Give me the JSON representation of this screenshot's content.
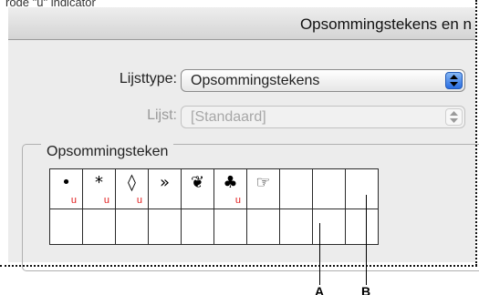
{
  "caption_top": "rode \"u\" indicator",
  "window": {
    "title": "Opsommingstekens en n"
  },
  "list_type": {
    "label": "Lijsttype:",
    "value": "Opsommingstekens",
    "arrow_icon": "up-down-arrows-icon"
  },
  "list": {
    "label": "Lijst:",
    "value": "[Standaard]",
    "arrow_icon": "up-down-arrows-icon"
  },
  "bullet_group": {
    "title": "Opsommingsteken",
    "cells": [
      {
        "symbol": "•",
        "indicator": "u"
      },
      {
        "symbol": "*",
        "indicator": "u"
      },
      {
        "symbol": "◊",
        "indicator": "u"
      },
      {
        "symbol": "»",
        "indicator": ""
      },
      {
        "symbol": "❦",
        "indicator": ""
      },
      {
        "symbol": "♣",
        "indicator": "u"
      },
      {
        "symbol": "☞",
        "indicator": ""
      },
      {
        "symbol": "",
        "indicator": ""
      },
      {
        "symbol": "",
        "indicator": ""
      },
      {
        "symbol": "",
        "indicator": ""
      }
    ]
  },
  "callouts": {
    "a": "A",
    "b": "B"
  },
  "colors": {
    "indicator": "#e01a1a",
    "accent": "#2a6ee3"
  }
}
